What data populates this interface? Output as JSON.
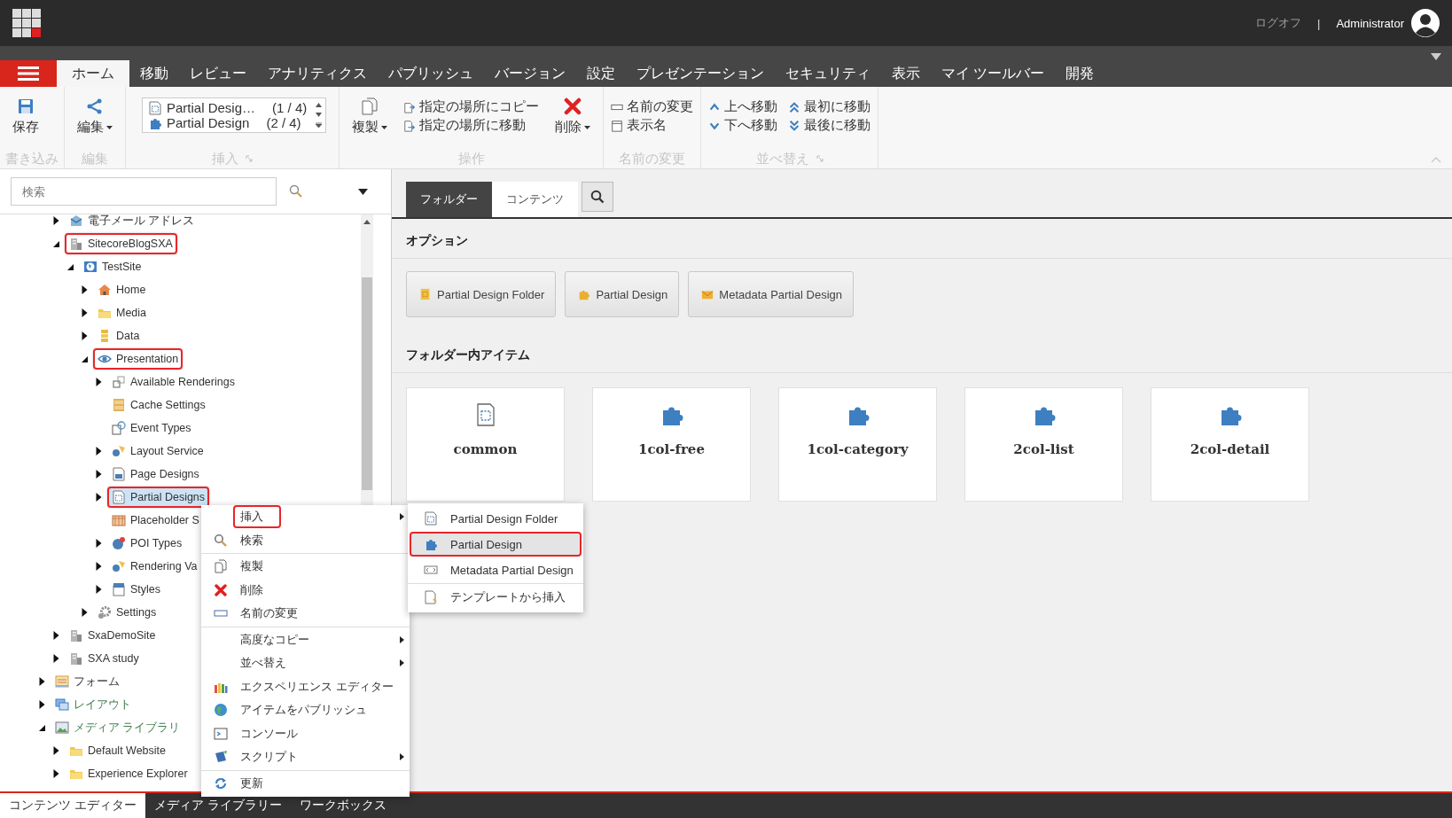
{
  "top_bar": {
    "logoff": "ログオフ",
    "separator": "|",
    "user": "Administrator"
  },
  "menu_tabs": [
    {
      "label": "ホーム",
      "selected": true
    },
    {
      "label": "移動",
      "selected": false
    },
    {
      "label": "レビュー",
      "selected": false
    },
    {
      "label": "アナリティクス",
      "selected": false
    },
    {
      "label": "パブリッシュ",
      "selected": false
    },
    {
      "label": "バージョン",
      "selected": false
    },
    {
      "label": "設定",
      "selected": false
    },
    {
      "label": "プレゼンテーション",
      "selected": false
    },
    {
      "label": "セキュリティ",
      "selected": false
    },
    {
      "label": "表示",
      "selected": false
    },
    {
      "label": "マイ ツールバー",
      "selected": false
    },
    {
      "label": "開発",
      "selected": false
    }
  ],
  "ribbon": {
    "groups": [
      {
        "label": "書き込み",
        "controls": [
          {
            "kind": "large",
            "label": "保存"
          }
        ]
      },
      {
        "label": "編集",
        "controls": [
          {
            "kind": "large",
            "label": "編集",
            "dropdown": true
          }
        ]
      },
      {
        "label": "挿入",
        "launcher": true,
        "controls": [
          {
            "kind": "gallery",
            "items": [
              {
                "name": "Partial Desig…",
                "position": "(1 / 4)"
              },
              {
                "name": "Partial Design",
                "position": "(2 / 4)"
              }
            ]
          }
        ]
      },
      {
        "label": "操作",
        "controls": [
          {
            "kind": "large",
            "label": "複製",
            "dropdown": true
          },
          {
            "kind": "stack",
            "items": [
              "指定の場所にコピー",
              "指定の場所に移動"
            ]
          },
          {
            "kind": "large",
            "label": "削除",
            "dropdown": true
          }
        ]
      },
      {
        "label": "名前の変更",
        "controls": [
          {
            "kind": "stack",
            "items": [
              "名前の変更",
              "表示名"
            ]
          }
        ]
      },
      {
        "label": "並べ替え",
        "launcher": true,
        "controls": [
          {
            "kind": "stack",
            "items": [
              "上へ移動",
              "下へ移動"
            ]
          },
          {
            "kind": "stack",
            "items": [
              "最初に移動",
              "最後に移動"
            ]
          }
        ]
      }
    ]
  },
  "search": {
    "placeholder": "検索"
  },
  "tree": {
    "continued_children": [
      {
        "label": "電子メール アドレス",
        "expanded": false,
        "selected": false,
        "annotated": false
      },
      {
        "label": "SitecoreBlogSXA",
        "expanded": true,
        "selected": false,
        "annotated": true,
        "children": [
          {
            "label": "TestSite",
            "expanded": true,
            "selected": false,
            "annotated": false,
            "children": [
              {
                "label": "Home",
                "expanded": false,
                "selected": false,
                "annotated": false
              },
              {
                "label": "Media",
                "expanded": false,
                "selected": false,
                "annotated": false
              },
              {
                "label": "Data",
                "expanded": false,
                "selected": false,
                "annotated": false
              },
              {
                "label": "Presentation",
                "expanded": true,
                "selected": false,
                "annotated": true,
                "children": [
                  {
                    "label": "Available Renderings",
                    "expanded": false,
                    "selected": false,
                    "annotated": false
                  },
                  {
                    "label": "Cache Settings",
                    "selected": false,
                    "annotated": false
                  },
                  {
                    "label": "Event Types",
                    "selected": false,
                    "annotated": false
                  },
                  {
                    "label": "Layout Service",
                    "expanded": false,
                    "selected": false,
                    "annotated": false
                  },
                  {
                    "label": "Page Designs",
                    "expanded": false,
                    "selected": false,
                    "annotated": false
                  },
                  {
                    "label": "Partial Designs",
                    "expanded": false,
                    "selected": true,
                    "annotated": true
                  },
                  {
                    "label": "Placeholder S",
                    "selected": false,
                    "annotated": false
                  },
                  {
                    "label": "POI Types",
                    "expanded": false,
                    "selected": false,
                    "annotated": false
                  },
                  {
                    "label": "Rendering Va",
                    "expanded": false,
                    "selected": false,
                    "annotated": false
                  },
                  {
                    "label": "Styles",
                    "expanded": false,
                    "selected": false,
                    "annotated": false
                  }
                ]
              },
              {
                "label": "Settings",
                "expanded": false,
                "selected": false,
                "annotated": false
              }
            ]
          }
        ]
      },
      {
        "label": "SxaDemoSite",
        "expanded": false,
        "selected": false,
        "annotated": false
      },
      {
        "label": "SXA study",
        "expanded": false,
        "selected": false,
        "annotated": false
      }
    ],
    "items": [
      {
        "label": "フォーム",
        "expanded": false,
        "selected": false,
        "annotated": false
      },
      {
        "label": "レイアウト",
        "expanded": false,
        "selected": false,
        "annotated": false,
        "color": "#3f7f4f"
      },
      {
        "label": "メディア ライブラリ",
        "expanded": true,
        "selected": false,
        "annotated": false,
        "color": "#3f7f4f",
        "children": [
          {
            "label": "Default Website",
            "expanded": false,
            "selected": false,
            "annotated": false
          },
          {
            "label": "Experience Explorer",
            "expanded": false,
            "selected": false,
            "annotated": false
          }
        ]
      }
    ]
  },
  "content_tabs": [
    {
      "label": "フォルダー",
      "selected": true
    },
    {
      "label": "コンテンツ",
      "selected": false
    }
  ],
  "options": {
    "title": "オプション",
    "buttons": [
      "Partial Design Folder",
      "Partial Design",
      "Metadata Partial Design"
    ]
  },
  "folder_items": {
    "title": "フォルダー内アイテム",
    "items": [
      {
        "name": "common",
        "kind": "folder"
      },
      {
        "name": "1col-free",
        "kind": "partial"
      },
      {
        "name": "1col-category",
        "kind": "partial"
      },
      {
        "name": "2col-list",
        "kind": "partial"
      },
      {
        "name": "2col-detail",
        "kind": "partial"
      }
    ]
  },
  "context_menu": {
    "items": [
      {
        "label": "挿入",
        "submenu": true,
        "annotated": true
      },
      {
        "label": "検索",
        "annotated": false
      },
      {
        "label": "複製",
        "annotated": false,
        "separator_before": true
      },
      {
        "label": "削除",
        "annotated": false
      },
      {
        "label": "名前の変更",
        "annotated": false
      },
      {
        "label": "高度なコピー",
        "submenu": true,
        "annotated": false,
        "separator_before": true
      },
      {
        "label": "並べ替え",
        "submenu": true,
        "annotated": false
      },
      {
        "label": "エクスペリエンス エディター",
        "annotated": false
      },
      {
        "label": "アイテムをパブリッシュ",
        "annotated": false
      },
      {
        "label": "コンソール",
        "annotated": false
      },
      {
        "label": "スクリプト",
        "submenu": true,
        "annotated": false
      },
      {
        "label": "更新",
        "annotated": false,
        "separator_before": true
      }
    ]
  },
  "submenu": {
    "items": [
      {
        "label": "Partial Design Folder",
        "selected": false,
        "annotated": false
      },
      {
        "label": "Partial Design",
        "selected": true,
        "annotated": true
      },
      {
        "label": "Metadata Partial Design",
        "selected": false,
        "annotated": false
      },
      {
        "label": "テンプレートから挿入",
        "selected": false,
        "annotated": false,
        "separator_before": true
      }
    ]
  },
  "bottom_tabs": [
    {
      "label": "コンテンツ エディター",
      "selected": true
    },
    {
      "label": "メディア ライブラリー",
      "selected": false
    },
    {
      "label": "ワークボックス",
      "selected": false
    }
  ]
}
